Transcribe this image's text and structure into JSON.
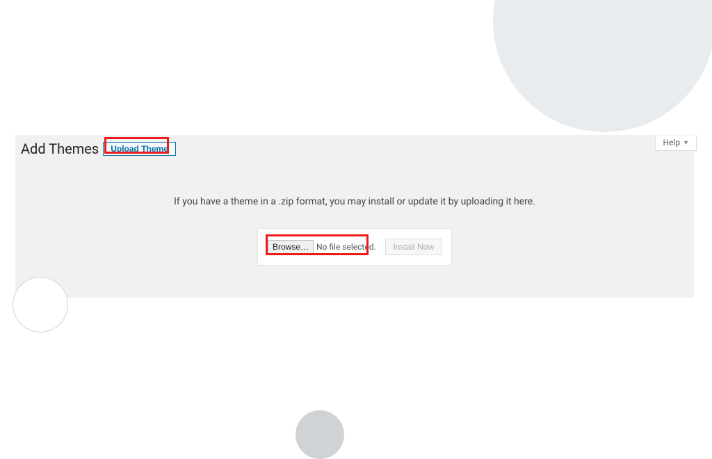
{
  "decor": {},
  "header": {
    "title": "Add Themes",
    "upload_button": "Upload Theme",
    "help_label": "Help"
  },
  "body": {
    "instruction": "If you have a theme in a .zip format, you may install or update it by uploading it here.",
    "browse_button": "Browse…",
    "file_status": "No file selected.",
    "install_button": "Install Now"
  }
}
